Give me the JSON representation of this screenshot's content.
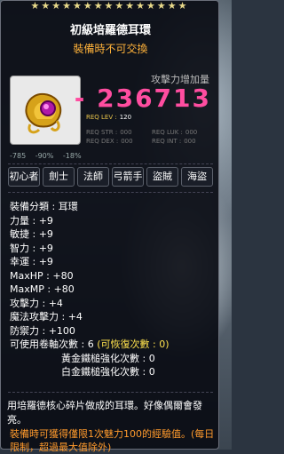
{
  "title": "初級培羅德耳環",
  "subtitle": "裝備時不可交換",
  "attack_increase_label": "攻擊力增加量",
  "attack_increase_value": "- 236713",
  "requirements": {
    "lev_label": "REQ LEV :",
    "lev_value": "120",
    "str_label": "REQ STR :",
    "str_value": "000",
    "dex_label": "REQ DEX :",
    "dex_value": "000",
    "luk_label": "REQ LUK :",
    "luk_value": "000",
    "int_label": "REQ INT :",
    "int_value": "000"
  },
  "mini_stats": [
    "-785",
    "-90%",
    "-18%"
  ],
  "jobs": [
    "初心者",
    "劍士",
    "法師",
    "弓箭手",
    "盜賊",
    "海盜"
  ],
  "attributes": [
    {
      "label": "裝備分類 : ",
      "value": "耳環"
    },
    {
      "label": "力量 : ",
      "value": "+9"
    },
    {
      "label": "敏捷 : ",
      "value": "+9"
    },
    {
      "label": "智力 : ",
      "value": "+9"
    },
    {
      "label": "幸運 : ",
      "value": "+9"
    },
    {
      "label": "MaxHP : ",
      "value": "+80"
    },
    {
      "label": "MaxMP : ",
      "value": "+80"
    },
    {
      "label": "攻擊力 : ",
      "value": "+4"
    },
    {
      "label": "魔法攻擊力 : ",
      "value": "+4"
    },
    {
      "label": "防禦力 : ",
      "value": "+100"
    }
  ],
  "upgrade": {
    "label": "可使用卷軸次數 : ",
    "value": "6",
    "recover": "(可恢復次數 : 0)"
  },
  "gold_hammer": "黃金鐵槌強化次數 : 0",
  "platinum_hammer": "白金鐵槌強化次數 : 0",
  "description": "用培羅德核心碎片做成的耳環。好像偶爾會發亮。",
  "warning": "裝備時可獲得僅限1次魅力100的經驗值。(每日限制，超過最大值除外)"
}
